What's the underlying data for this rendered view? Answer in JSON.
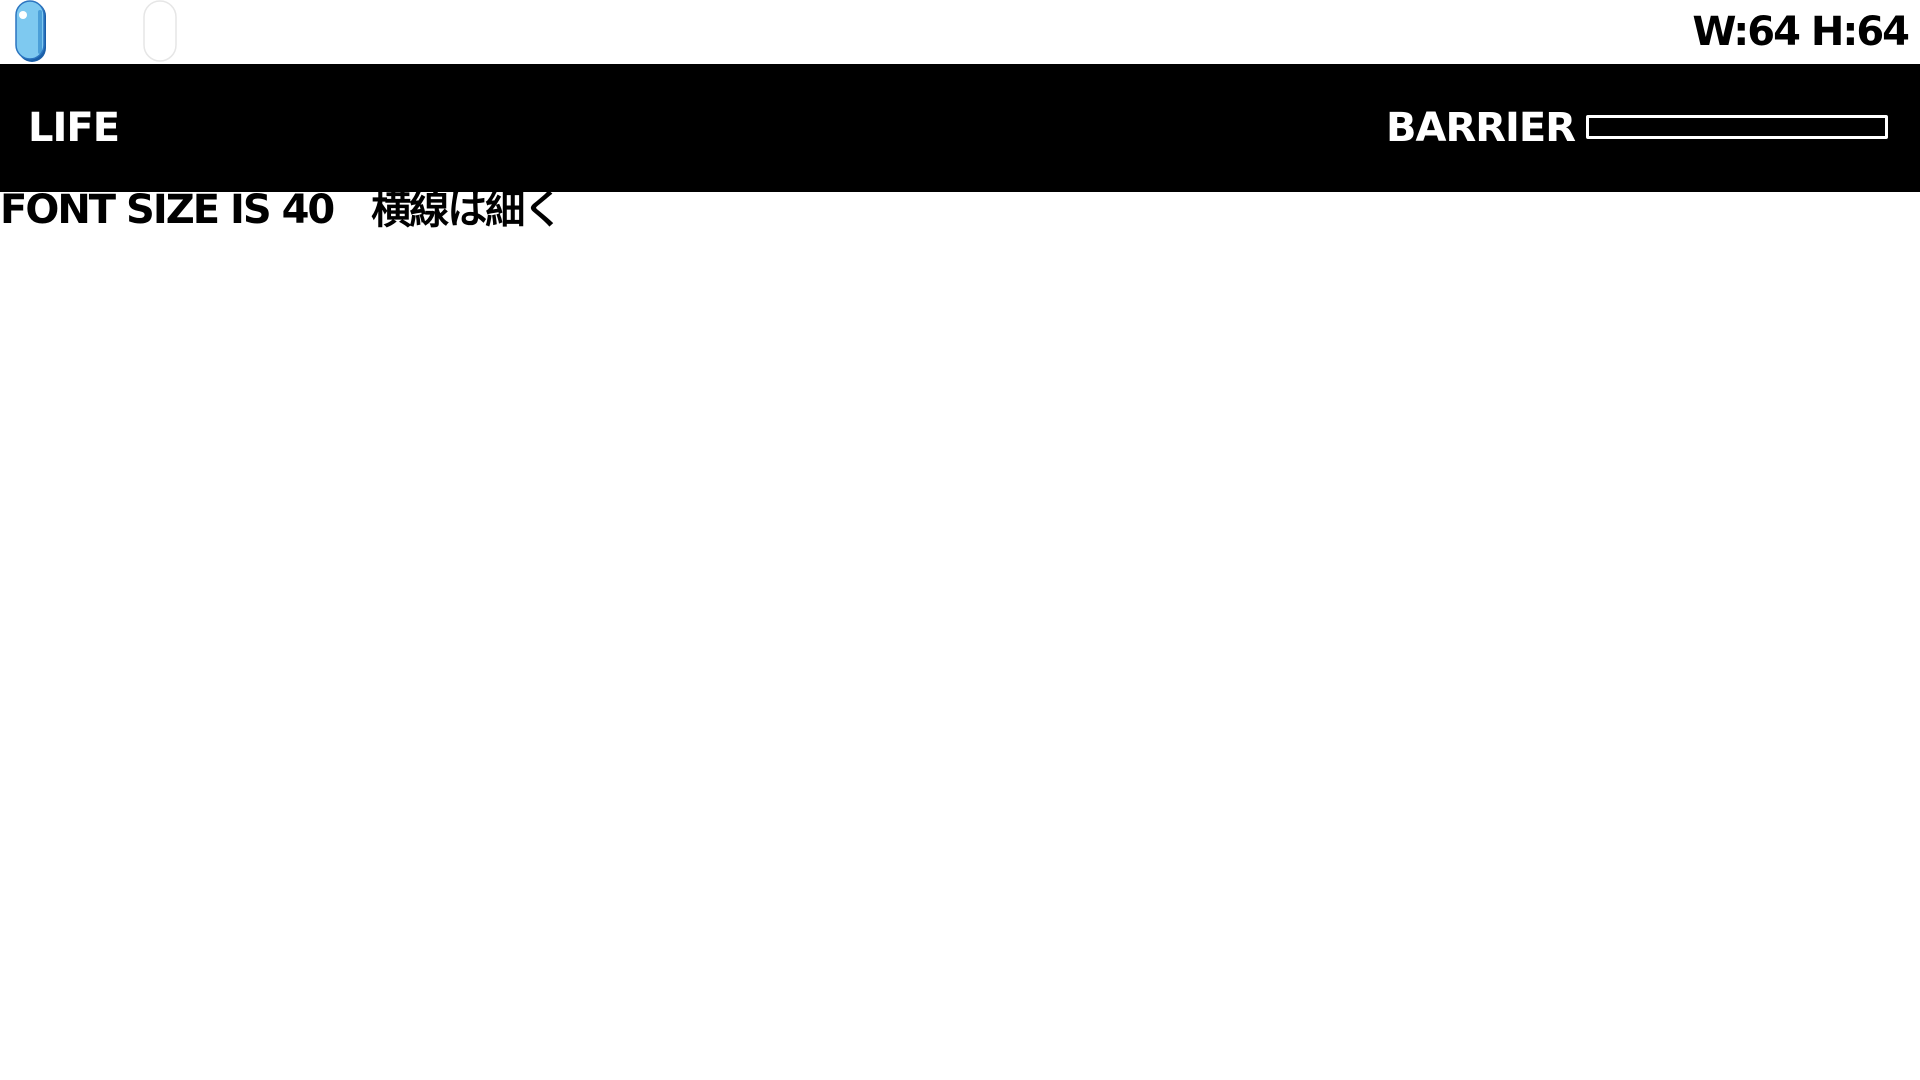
{
  "top_bar": {
    "size_readout": "W:64 H:64",
    "sprites": [
      {
        "name": "blue-capsule-icon",
        "fill": "#7ec9f0",
        "outline": "#1a5fa8",
        "highlight": "#ffffff"
      },
      {
        "name": "empty-capsule-slot-icon",
        "fill": "#ffffff",
        "outline": "#e6e6e6"
      }
    ]
  },
  "hud": {
    "life_label": "LIFE",
    "barrier_label": "BARRIER",
    "barrier_level": 0,
    "background": "#000000",
    "text_color": "#ffffff"
  },
  "caption": {
    "text": "FONT SIZE IS 40　横線は細く"
  }
}
